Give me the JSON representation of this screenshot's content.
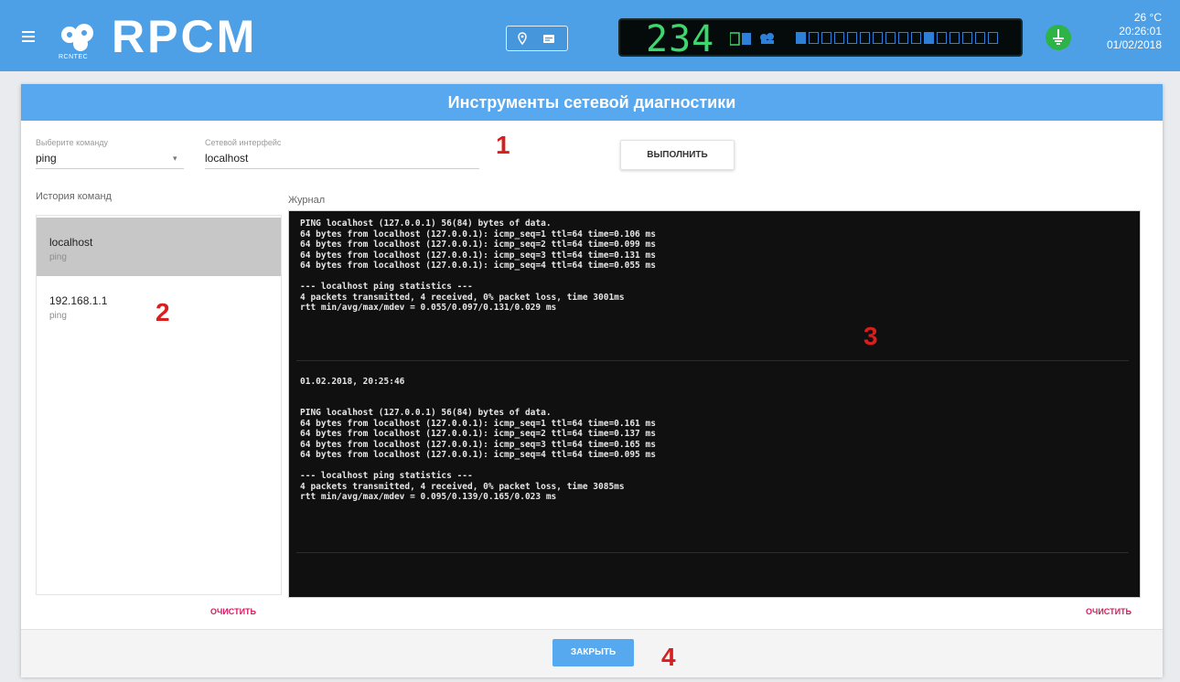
{
  "topbar": {
    "brand_text": "RPCM",
    "brand_sub": "RCNTEC",
    "display_value": "234",
    "temperature": "26 °C",
    "time": "20:26:01",
    "date": "01/02/2018",
    "accent_color": "#4d9fe6"
  },
  "dialog": {
    "title": "Инструменты сетевой диагностики",
    "command_field": {
      "label": "Выберите команду",
      "value": "ping"
    },
    "address_field": {
      "label": "Сетевой интерфейс",
      "value": "localhost"
    },
    "execute_label": "ВЫПОЛНИТЬ",
    "history_label": "История команд",
    "log_label": "Журнал",
    "history_items": [
      {
        "title": "localhost",
        "sub": "ping"
      },
      {
        "title": "192.168.1.1",
        "sub": "ping"
      }
    ],
    "log_block_1": "PING localhost (127.0.0.1) 56(84) bytes of data.\n64 bytes from localhost (127.0.0.1): icmp_seq=1 ttl=64 time=0.106 ms\n64 bytes from localhost (127.0.0.1): icmp_seq=2 ttl=64 time=0.099 ms\n64 bytes from localhost (127.0.0.1): icmp_seq=3 ttl=64 time=0.131 ms\n64 bytes from localhost (127.0.0.1): icmp_seq=4 ttl=64 time=0.055 ms\n\n--- localhost ping statistics ---\n4 packets transmitted, 4 received, 0% packet loss, time 3001ms\nrtt min/avg/max/mdev = 0.055/0.097/0.131/0.029 ms",
    "log_timestamp": "01.02.2018, 20:25:46",
    "log_block_2": "PING localhost (127.0.0.1) 56(84) bytes of data.\n64 bytes from localhost (127.0.0.1): icmp_seq=1 ttl=64 time=0.161 ms\n64 bytes from localhost (127.0.0.1): icmp_seq=2 ttl=64 time=0.137 ms\n64 bytes from localhost (127.0.0.1): icmp_seq=3 ttl=64 time=0.165 ms\n64 bytes from localhost (127.0.0.1): icmp_seq=4 ttl=64 time=0.095 ms\n\n--- localhost ping statistics ---\n4 packets transmitted, 4 received, 0% packet loss, time 3085ms\nrtt min/avg/max/mdev = 0.095/0.139/0.165/0.023 ms",
    "clear_history_label": "ОЧИСТИТЬ",
    "clear_log_label": "ОЧИСТИТЬ",
    "close_label": "ЗАКРЫТЬ"
  },
  "markers": {
    "m1": "1",
    "m2": "2",
    "m3": "3",
    "m4": "4"
  }
}
